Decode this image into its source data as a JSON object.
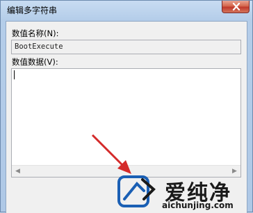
{
  "window": {
    "title": "编辑多字符串"
  },
  "form": {
    "name_label": "数值名称(N):",
    "name_value": "BootExecute",
    "data_label": "数值数据(V):",
    "data_value": ""
  },
  "scrollbar": {
    "left_arrow": "◀",
    "right_arrow": "▶"
  },
  "watermark": {
    "brand": "爱纯净",
    "url": "aichunjing.com"
  },
  "icons": [
    "close-icon",
    "scroll-left-icon",
    "scroll-right-icon",
    "pointer-arrow-icon",
    "brand-logo-icon"
  ]
}
